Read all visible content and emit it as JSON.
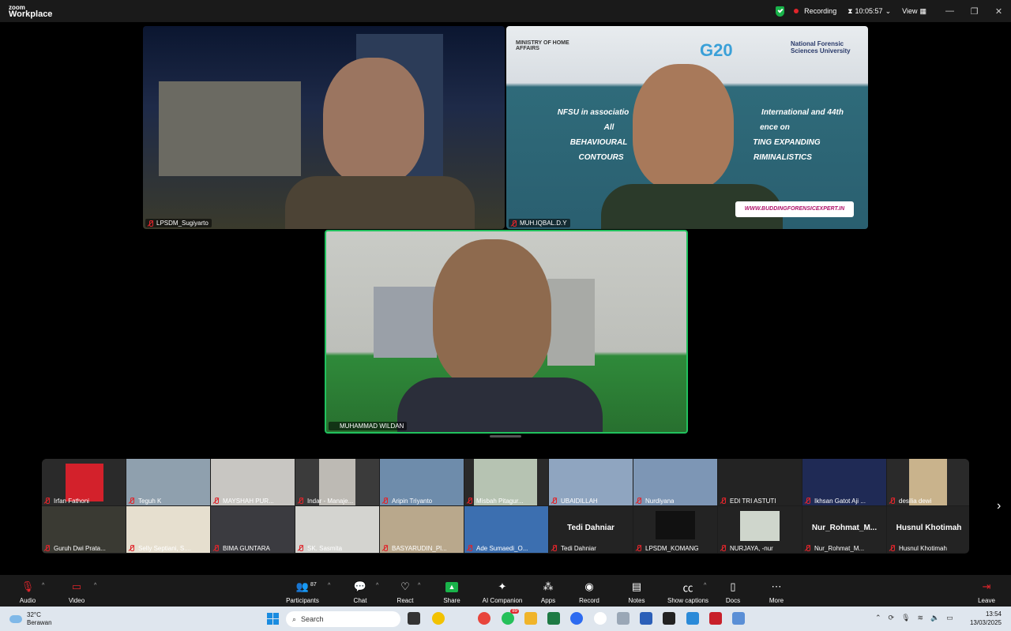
{
  "app": {
    "brand_line1": "zoom",
    "brand_line2": "Workplace"
  },
  "titlebar": {
    "recording_label": "Recording",
    "timer": "10:05:57",
    "view_label": "View",
    "minimize": "—",
    "restore": "❐",
    "close": "✕"
  },
  "main_tiles": [
    {
      "name": "LPSDM_Sugiyarto"
    },
    {
      "name": "MUH.IQBAL.D.Y"
    },
    {
      "name": "MUHAMMAD WILDAN"
    }
  ],
  "banner": {
    "ministry": "MINISTRY OF HOME AFFAIRS",
    "g20": "G20",
    "university": "National Forensic Sciences University",
    "line1": "NFSU in associatio",
    "line1b": "International and 44th",
    "line2": "All",
    "line2b": "ence on",
    "line3": "BEHAVIOURAL",
    "line3b": "TING EXPANDING",
    "line4": "CONTOURS",
    "line4b": "RIMINALISTICS",
    "website": "WWW.BUDDINGFORENSICEXPERT.IN"
  },
  "strip_row1": [
    {
      "name": "Irfan Fathoni"
    },
    {
      "name": "Teguh K"
    },
    {
      "name": "MAYSHAH PUR..."
    },
    {
      "name": "Indar - Manaje..."
    },
    {
      "name": "Aripin Triyanto"
    },
    {
      "name": "Misbah Pitagur..."
    },
    {
      "name": "UBAIDILLAH"
    },
    {
      "name": "Nurdiyana"
    },
    {
      "name": "EDI TRI ASTUTI"
    },
    {
      "name": "Ikhsan Gatot Aji ..."
    },
    {
      "name": "desilia dewi"
    }
  ],
  "strip_row2": [
    {
      "name": "Guruh Dwi Prata...",
      "big": ""
    },
    {
      "name": "Selly Septiani, S....",
      "big": ""
    },
    {
      "name": "BIMA GUNTARA",
      "big": ""
    },
    {
      "name": "SK. Sasmita",
      "big": ""
    },
    {
      "name": "BASYARUDIN_Pl...",
      "big": ""
    },
    {
      "name": "Ade Sumaedi_O...",
      "big": ""
    },
    {
      "name": "Tedi Dahniar",
      "big": "Tedi Dahniar"
    },
    {
      "name": "LPSDM_KOMANG",
      "big": ""
    },
    {
      "name": "NURJAYA, -nur",
      "big": ""
    },
    {
      "name": "Nur_Rohmat_M...",
      "big": "Nur_Rohmat_M..."
    },
    {
      "name": "Husnul Khotimah",
      "big": "Husnul Khotimah"
    }
  ],
  "toolbar": {
    "audio": "Audio",
    "video": "Video",
    "participants": "Participants",
    "participants_count": "87",
    "chat": "Chat",
    "react": "React",
    "share": "Share",
    "ai_companion": "AI Companion",
    "apps": "Apps",
    "record": "Record",
    "notes": "Notes",
    "captions": "Show captions",
    "docs": "Docs",
    "more": "More",
    "leave": "Leave"
  },
  "taskbar": {
    "temp": "32°C",
    "weather": "Berawan",
    "search": "Search",
    "whatsapp_badge": "89",
    "time": "13:54",
    "date": "13/03/2025"
  },
  "colors": {
    "active_speaker": "#21c25e",
    "record_red": "#e0252b",
    "share_green": "#19b34a"
  }
}
